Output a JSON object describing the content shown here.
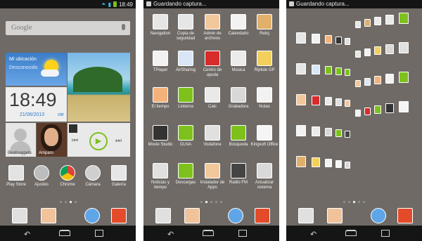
{
  "panel1": {
    "status_time": "18:49",
    "search_placeholder": "Google",
    "weather": {
      "location": "Mi ubicación",
      "status": "Desconocido"
    },
    "clock": {
      "time": "18:49",
      "date": "21/06/2013",
      "day": "vie"
    },
    "contacts": [
      {
        "name": "Beatnuggets"
      },
      {
        "name": "Amparo"
      }
    ],
    "apps": [
      {
        "label": "Play Store",
        "color": "#e3e3e3"
      },
      {
        "label": "Ajustes",
        "color": "#bdbdbd"
      },
      {
        "label": "Chrome",
        "color": "#ffffff"
      },
      {
        "label": "Cámara",
        "color": "#cfcfcf"
      },
      {
        "label": "Galería",
        "color": "#e6e6e6"
      }
    ]
  },
  "panel2": {
    "status_title": "Guardando captura...",
    "apps": [
      {
        "label": "Navigation",
        "color": "#e6e6e6"
      },
      {
        "label": "Copia de seguridad",
        "color": "#e6e6e6"
      },
      {
        "label": "Admin de archivos",
        "color": "#f3c79c"
      },
      {
        "label": "Calendario",
        "color": "#f2f2f2"
      },
      {
        "label": "Reloj",
        "color": "#e1b06b"
      },
      {
        "label": "TPlayer",
        "color": "#f2f2f2"
      },
      {
        "label": "AirSharing",
        "color": "#d8e6f5"
      },
      {
        "label": "Centro de ayuda",
        "color": "#d82b2b"
      },
      {
        "label": "Música",
        "color": "#ebebeb"
      },
      {
        "label": "Riptide GP",
        "color": "#f1d05d"
      },
      {
        "label": "El tiempo",
        "color": "#f4b27b"
      },
      {
        "label": "Linterna",
        "color": "#7ec11c"
      },
      {
        "label": "Calc",
        "color": "#e9e9e9"
      },
      {
        "label": "Grabadora",
        "color": "#d8d8d8"
      },
      {
        "label": "Notas",
        "color": "#f2f2f2"
      },
      {
        "label": "Movie Studio",
        "color": "#333333"
      },
      {
        "label": "DLNA",
        "color": "#7ec11c"
      },
      {
        "label": "Vodafone",
        "color": "#e0e0e0"
      },
      {
        "label": "Búsqueda",
        "color": "#7ec11c"
      },
      {
        "label": "Kingsoft Office",
        "color": "#f5f5f5"
      },
      {
        "label": "Noticias y tiempo",
        "color": "#e0e0e0"
      },
      {
        "label": "Descargas",
        "color": "#7ec11c"
      },
      {
        "label": "Instalador de Apps",
        "color": "#f3c79c"
      },
      {
        "label": "Radio FM",
        "color": "#444444"
      },
      {
        "label": "Actualizar sistema",
        "color": "#d9d9d9"
      }
    ]
  },
  "panel3": {
    "status_title": "Guardando captura..."
  },
  "dock": [
    {
      "name": "apps",
      "color": "#e0e0e0"
    },
    {
      "name": "messages",
      "color": "#f0c39a"
    },
    {
      "name": "browser",
      "color": "#5fa6e8"
    },
    {
      "name": "phone",
      "color": "#e34b2a"
    }
  ]
}
